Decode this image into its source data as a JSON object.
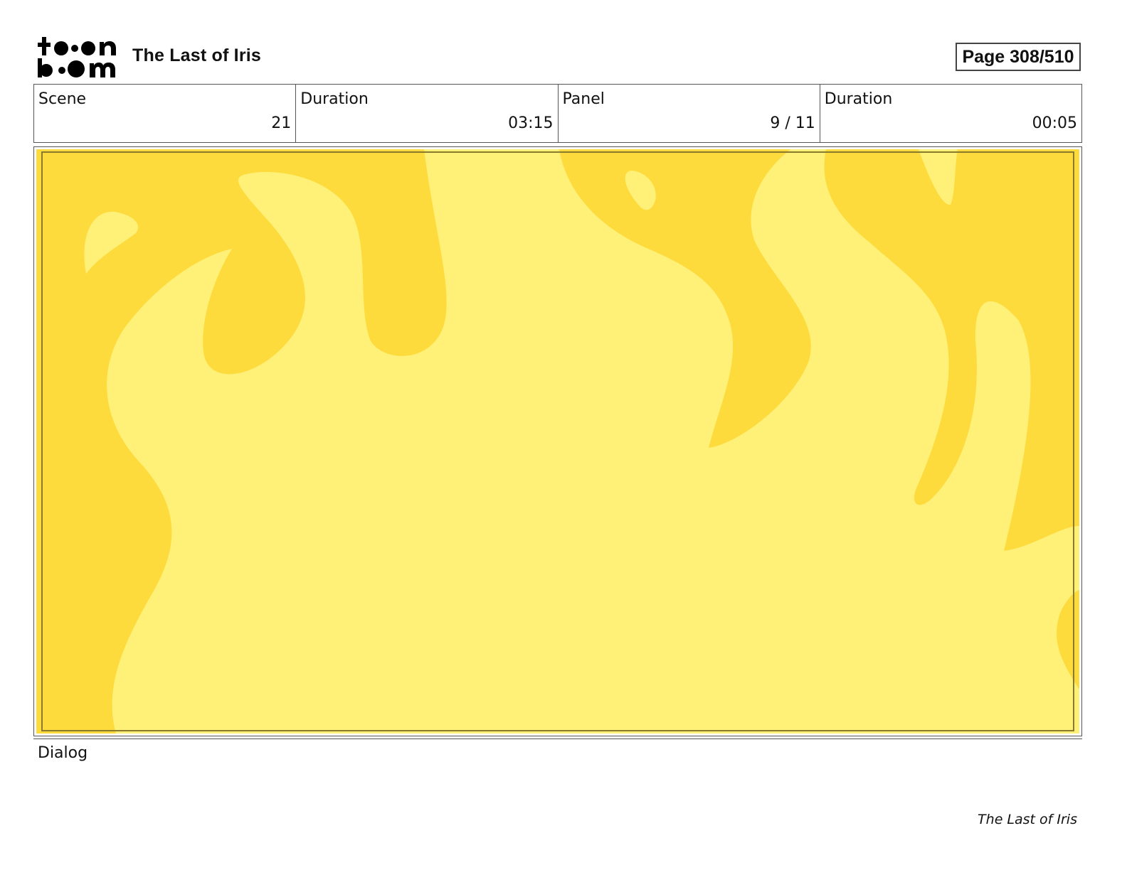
{
  "brand": {
    "logo_text": "toon boom"
  },
  "header": {
    "project_title": "The Last of Iris",
    "page_indicator": "Page 308/510"
  },
  "info": [
    {
      "label": "Scene",
      "value": "21"
    },
    {
      "label": "Duration",
      "value": "03:15"
    },
    {
      "label": "Panel",
      "value": "9 / 11"
    },
    {
      "label": "Duration",
      "value": "00:05"
    }
  ],
  "panel": {
    "colors": {
      "dark_flame": "#FEDB3D",
      "light_flame": "#FFF077",
      "outline": "#8A7A2E"
    }
  },
  "dialog": {
    "label": "Dialog"
  },
  "footer": {
    "title": "The Last of Iris"
  }
}
